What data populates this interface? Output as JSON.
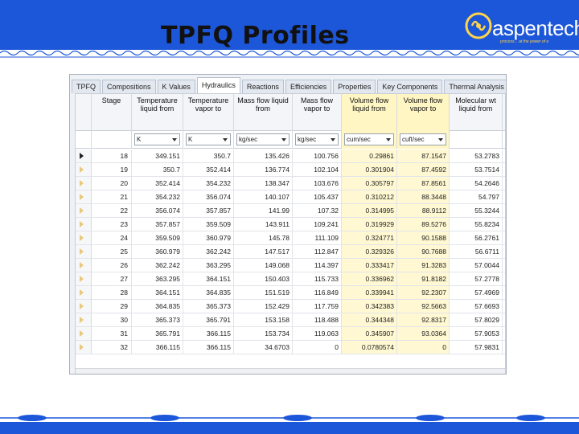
{
  "slide": {
    "title": "TPFQ Profiles",
    "logo_text": "aspentech",
    "logo_tagline": "process... at the power of e",
    "brand_blue": "#1c56d9",
    "accent_yellow": "#fff6c4"
  },
  "tabs": [
    {
      "label": "TPFQ",
      "active": false
    },
    {
      "label": "Compositions",
      "active": false
    },
    {
      "label": "K Values",
      "active": false
    },
    {
      "label": "Hydraulics",
      "active": true
    },
    {
      "label": "Reactions",
      "active": false
    },
    {
      "label": "Efficiencies",
      "active": false
    },
    {
      "label": "Properties",
      "active": false
    },
    {
      "label": "Key Components",
      "active": false
    },
    {
      "label": "Thermal Analysis",
      "active": false
    }
  ],
  "grid": {
    "columns": [
      {
        "header": "Stage",
        "unit": null
      },
      {
        "header": "Temperature liquid from",
        "unit": "K"
      },
      {
        "header": "Temperature vapor to",
        "unit": "K"
      },
      {
        "header": "Mass flow liquid from",
        "unit": "kg/sec"
      },
      {
        "header": "Mass flow vapor to",
        "unit": "kg/sec"
      },
      {
        "header": "Volume flow liquid from",
        "unit": "cum/sec"
      },
      {
        "header": "Volume flow vapor to",
        "unit": "cuft/sec"
      },
      {
        "header": "Molecular wt liquid from",
        "unit": null
      }
    ],
    "rows": [
      [
        "18",
        "349.151",
        "350.7",
        "135.426",
        "100.756",
        "0.29861",
        "87.1547",
        "53.2783"
      ],
      [
        "19",
        "350.7",
        "352.414",
        "136.774",
        "102.104",
        "0.301904",
        "87.4592",
        "53.7514"
      ],
      [
        "20",
        "352.414",
        "354.232",
        "138.347",
        "103.676",
        "0.305797",
        "87.8561",
        "54.2646"
      ],
      [
        "21",
        "354.232",
        "356.074",
        "140.107",
        "105.437",
        "0.310212",
        "88.3448",
        "54.797"
      ],
      [
        "22",
        "356.074",
        "357.857",
        "141.99",
        "107.32",
        "0.314995",
        "88.9112",
        "55.3244"
      ],
      [
        "23",
        "357.857",
        "359.509",
        "143.911",
        "109.241",
        "0.319929",
        "89.5276",
        "55.8234"
      ],
      [
        "24",
        "359.509",
        "360.979",
        "145.78",
        "111.109",
        "0.324771",
        "90.1588",
        "56.2761"
      ],
      [
        "25",
        "360.979",
        "362.242",
        "147.517",
        "112.847",
        "0.329326",
        "90.7688",
        "56.6711"
      ],
      [
        "26",
        "362.242",
        "363.295",
        "149.068",
        "114.397",
        "0.333417",
        "91.3283",
        "57.0044"
      ],
      [
        "27",
        "363.295",
        "364.151",
        "150.403",
        "115.733",
        "0.336962",
        "91.8182",
        "57.2778"
      ],
      [
        "28",
        "364.151",
        "364.835",
        "151.519",
        "116.849",
        "0.339941",
        "92.2307",
        "57.4969"
      ],
      [
        "29",
        "364.835",
        "365.373",
        "152.429",
        "117.759",
        "0.342383",
        "92.5663",
        "57.6693"
      ],
      [
        "30",
        "365.373",
        "365.791",
        "153.158",
        "118.488",
        "0.344348",
        "92.8317",
        "57.8029"
      ],
      [
        "31",
        "365.791",
        "366.115",
        "153.734",
        "119.063",
        "0.345907",
        "93.0364",
        "57.9053"
      ],
      [
        "32",
        "366.115",
        "366.115",
        "34.6703",
        "0",
        "0.0780574",
        "0",
        "57.9831"
      ]
    ],
    "current_row": 0
  }
}
